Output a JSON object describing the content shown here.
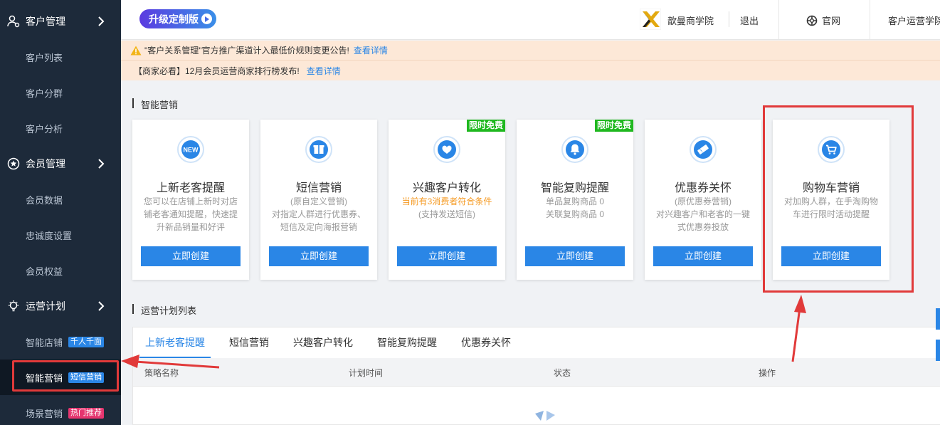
{
  "sidebar": {
    "groups": [
      {
        "label": "客户管理",
        "icon": "user-gear-icon",
        "items": [
          "客户列表",
          "客户分群",
          "客户分析"
        ]
      },
      {
        "label": "会员管理",
        "icon": "star-circle-icon",
        "items": [
          "会员数据",
          "忠诚度设置",
          "会员权益"
        ]
      },
      {
        "label": "运营计划",
        "icon": "lightbulb-icon",
        "items": [
          "智能店铺",
          "智能营销",
          "场景营销"
        ]
      }
    ],
    "tags": {
      "smart_store": "千人千面",
      "smart_marketing": "短信营销",
      "scene_marketing": "热门推荐"
    },
    "active_item": "智能营销"
  },
  "header": {
    "upgrade_label": "升级定制版",
    "school_name": "歆曼商学院",
    "logout": "退出",
    "official_site": "官网",
    "academy": "客户运营学院"
  },
  "notices": [
    {
      "text": "\"客户关系管理\"官方推广渠道计入最低价规则变更公告!",
      "link": "查看详情"
    },
    {
      "text": "【商家必看】12月会员运营商家排行榜发布!",
      "link": "查看详情"
    }
  ],
  "smart_marketing": {
    "title": "智能营销",
    "cards": [
      {
        "title": "上新老客提醒",
        "icon": "new-badge-icon",
        "desc": [
          "您可以在店铺上新时对店",
          "铺老客通知提醒，快速提",
          "升新品销量和好评"
        ],
        "button": "立即创建"
      },
      {
        "title": "短信营销",
        "icon": "gift-icon",
        "desc": [
          "(原自定义营销)",
          "对指定人群进行优惠券、",
          "短信及定向海报营销"
        ],
        "button": "立即创建"
      },
      {
        "title": "兴趣客户转化",
        "icon": "heart-icon",
        "badge": "限时免费",
        "highlight": "当前有3消费者符合条件",
        "desc": [
          "(支持发送短信)"
        ],
        "button": "立即创建"
      },
      {
        "title": "智能复购提醒",
        "icon": "bell-icon",
        "badge": "限时免费",
        "desc": [
          "单品复购商品 0",
          "关联复购商品 0"
        ],
        "button": "立即创建"
      },
      {
        "title": "优惠券关怀",
        "icon": "coupon-icon",
        "desc": [
          "(原优惠券营销)",
          "对兴趣客户和老客的一键",
          "式优惠券投放"
        ],
        "button": "立即创建"
      },
      {
        "title": "购物车营销",
        "icon": "cart-icon",
        "desc": [
          "对加购人群，在手淘购物",
          "车进行限时活动提醒"
        ],
        "button": "立即创建"
      }
    ]
  },
  "plan_list": {
    "title": "运营计划列表",
    "tabs": [
      "上新老客提醒",
      "短信营销",
      "兴趣客户转化",
      "智能复购提醒",
      "优惠券关怀"
    ],
    "active_tab": "上新老客提醒",
    "columns": [
      "策略名称",
      "计划时间",
      "状态",
      "操作"
    ]
  },
  "colors": {
    "accent": "#2a86e6",
    "sidebar_bg": "#1d2a3a",
    "highlight_red": "#e13a3a",
    "free_badge": "#1fb81f"
  }
}
